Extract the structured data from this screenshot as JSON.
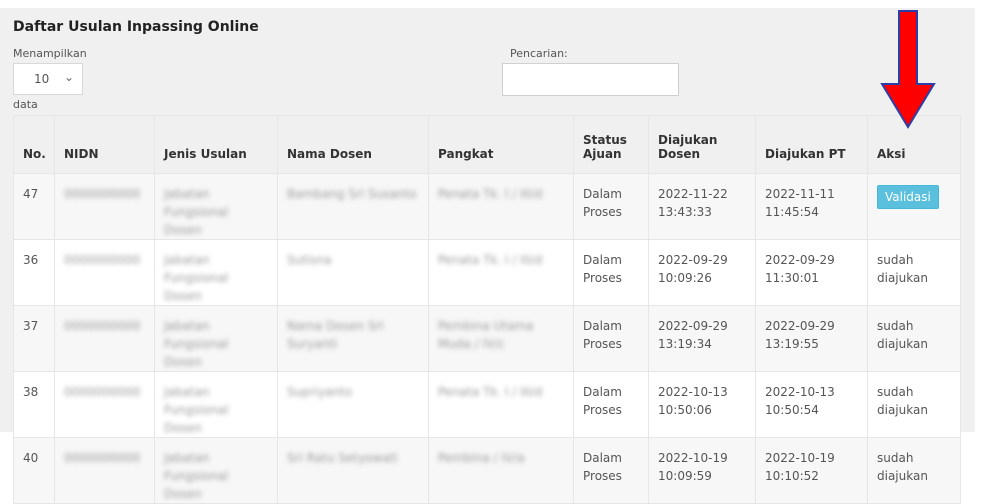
{
  "title": "Daftar Usulan Inpassing Online",
  "length_menu": {
    "label": "Menampilkan",
    "value": "10",
    "suffix": "data"
  },
  "search": {
    "label": "Pencarian:",
    "value": ""
  },
  "table": {
    "headers": [
      "No.",
      "NIDN",
      "Jenis Usulan",
      "Nama Dosen",
      "Pangkat",
      "Status Ajuan",
      "Diajukan Dosen",
      "Diajukan PT",
      "Aksi"
    ],
    "rows": [
      {
        "no": "47",
        "nidn": "0000000000",
        "jenis": "Jabatan Fungsional Dosen",
        "nama": "Bambang Sri Susanto",
        "pangkat": "Penata Tk. I / III/d",
        "status": "Dalam Proses",
        "dosen": "2022-11-22 13:43:33",
        "pt": "2022-11-11 11:45:54",
        "aksi": "Validasi"
      },
      {
        "no": "36",
        "nidn": "0000000000",
        "jenis": "Jabatan Fungsional Dosen",
        "nama": "Sutisna",
        "pangkat": "Penata Tk. I / III/d",
        "status": "Dalam Proses",
        "dosen": "2022-09-29 10:09:26",
        "pt": "2022-09-29 11:30:01",
        "aksi": "sudah diajukan"
      },
      {
        "no": "37",
        "nidn": "0000000000",
        "jenis": "Jabatan Fungsional Dosen",
        "nama": "Nama Dosen Sri Suryanti",
        "pangkat": "Pembina Utama Muda / IV/c",
        "status": "Dalam Proses",
        "dosen": "2022-09-29 13:19:34",
        "pt": "2022-09-29 13:19:55",
        "aksi": "sudah diajukan"
      },
      {
        "no": "38",
        "nidn": "0000000000",
        "jenis": "Jabatan Fungsional Dosen",
        "nama": "Supriyanto",
        "pangkat": "Penata Tk. I / III/d",
        "status": "Dalam Proses",
        "dosen": "2022-10-13 10:50:06",
        "pt": "2022-10-13 10:50:54",
        "aksi": "sudah diajukan"
      },
      {
        "no": "40",
        "nidn": "0000000000",
        "jenis": "Jabatan Fungsional Dosen",
        "nama": "Sri Ratu Setyowati",
        "pangkat": "Pembina / IV/a",
        "status": "Dalam Proses",
        "dosen": "2022-10-19 10:09:59",
        "pt": "2022-10-19 10:10:52",
        "aksi": "sudah diajukan"
      }
    ]
  },
  "annotation": {
    "arrow_color": "#ff0000",
    "arrow_outline": "#2b3ea8",
    "arrow_points_to": "Aksi"
  },
  "colors": {
    "button_info": "#5bc0de",
    "panel_bg": "#f0f0f0"
  }
}
